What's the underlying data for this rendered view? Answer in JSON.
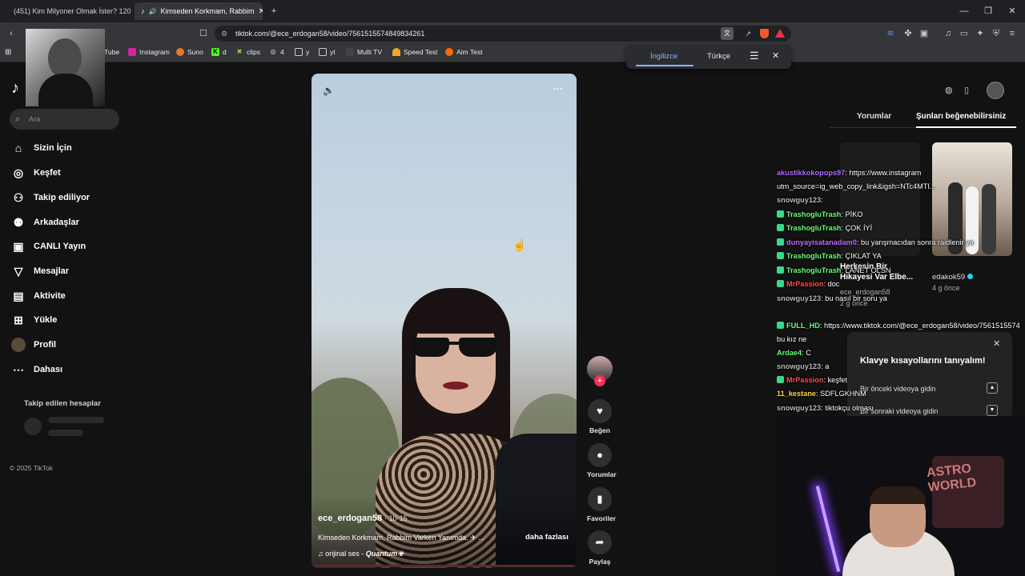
{
  "browser": {
    "tabs": [
      {
        "title": "(451) Kim Milyoner Olmak İster? 120"
      },
      {
        "title": "Kimseden Korkmam, Rabbim"
      }
    ],
    "url": "tiktok.com/@ece_erdogan58/video/7561515574849834261",
    "bookmarks": [
      "Tube",
      "Instagram",
      "Suno",
      "d",
      "clips",
      "4",
      "y",
      "yt",
      "Multi TV",
      "Speed Test",
      "Aim Test"
    ]
  },
  "translate_popup": {
    "source": "İngilizce",
    "target": "Türkçe"
  },
  "sidebar": {
    "search_placeholder": "Ara",
    "items": [
      {
        "label": "Sizin İçin",
        "icon": "home-icon"
      },
      {
        "label": "Keşfet",
        "icon": "compass-icon"
      },
      {
        "label": "Takip ediliyor",
        "icon": "following-icon"
      },
      {
        "label": "Arkadaşlar",
        "icon": "friends-icon"
      },
      {
        "label": "CANLI Yayın",
        "icon": "live-icon"
      },
      {
        "label": "Mesajlar",
        "icon": "messages-icon"
      },
      {
        "label": "Aktivite",
        "icon": "activity-icon"
      },
      {
        "label": "Yükle",
        "icon": "upload-icon"
      },
      {
        "label": "Profil",
        "icon": "profile-icon"
      },
      {
        "label": "Dahası",
        "icon": "more-icon"
      }
    ],
    "followed_header": "Takip edilen hesaplar",
    "copyright": "© 2025 TikTok"
  },
  "video": {
    "author": "ece_erdogan58",
    "date": "10-15",
    "caption": "Kimseden Korkmam, Rabbim Varken Yanımda.",
    "more_label": "daha fazlası",
    "sound_prefix": "orijinal ses - ",
    "sound_name": "Quantum☣"
  },
  "actions": {
    "like": "Beğen",
    "comments": "Yorumlar",
    "favorites": "Favoriler",
    "share": "Paylaş"
  },
  "right_panel": {
    "tabs": [
      "Yorumlar",
      "Şunları beğenebilirsiniz"
    ],
    "cards": [
      {
        "title": "Herkesin Bir Hikayesi Var Elbe...",
        "author": "ece_erdogan58",
        "time": "2 g önce"
      },
      {
        "title": "",
        "author": "edakok59",
        "time": "4 g önce"
      }
    ]
  },
  "keyboard_popup": {
    "title": "Klavye kısayollarını tanıyalım!",
    "items": [
      "Bir önceki videoya gidin",
      "Bir sonraki videoya gidin"
    ]
  },
  "chat": [
    {
      "user": "akustikkokopops97",
      "msg": "https://www.instagram",
      "color": "#b26bff"
    },
    {
      "user": "",
      "msg": "utm_source=ig_web_copy_link&igsh=NTc4MTI...",
      "color": "#ffffff"
    },
    {
      "user": "snowguy123",
      "msg": "",
      "color": "#b7b7b7"
    },
    {
      "user": "TrashogluTrash",
      "msg": "PİKO",
      "color": "#6aff7a"
    },
    {
      "user": "TrashogluTrash",
      "msg": "ÇOK İYİ",
      "color": "#6aff7a"
    },
    {
      "user": "dunyayisatanadam0",
      "msg": "bu yarışmacıdan sonra raidlenir ya",
      "color": "#c06cff"
    },
    {
      "user": "TrashogluTrash",
      "msg": "ÇIKLAT YA",
      "color": "#6aff7a"
    },
    {
      "user": "TrashogluTrash",
      "msg": "LANET OLSN",
      "color": "#6aff7a"
    },
    {
      "user": "MrPassion",
      "msg": "doc",
      "color": "#ff4b4b"
    },
    {
      "user": "snowguy123",
      "msg": "bu nasıl bir soru ya",
      "color": "#b7b7b7"
    },
    {
      "user": "FULL_HD",
      "msg": "https://www.tiktok.com/@ece_erdogan58/video/7561515574",
      "color": "#6aff7a"
    },
    {
      "user": "",
      "msg": "bu kız ne",
      "color": "#ffffff"
    },
    {
      "user": "Ardae4",
      "msg": "C",
      "color": "#6aff7a"
    },
    {
      "user": "snowguy123",
      "msg": "a",
      "color": "#b7b7b7"
    },
    {
      "user": "MrPassion",
      "msg": "keşfet",
      "color": "#ff4b4b"
    },
    {
      "user": "11_kestane",
      "msg": "SDFLGKHNM",
      "color": "#ffd24b"
    },
    {
      "user": "snowguy123",
      "msg": "tiktokçu olması",
      "color": "#b7b7b7"
    }
  ]
}
